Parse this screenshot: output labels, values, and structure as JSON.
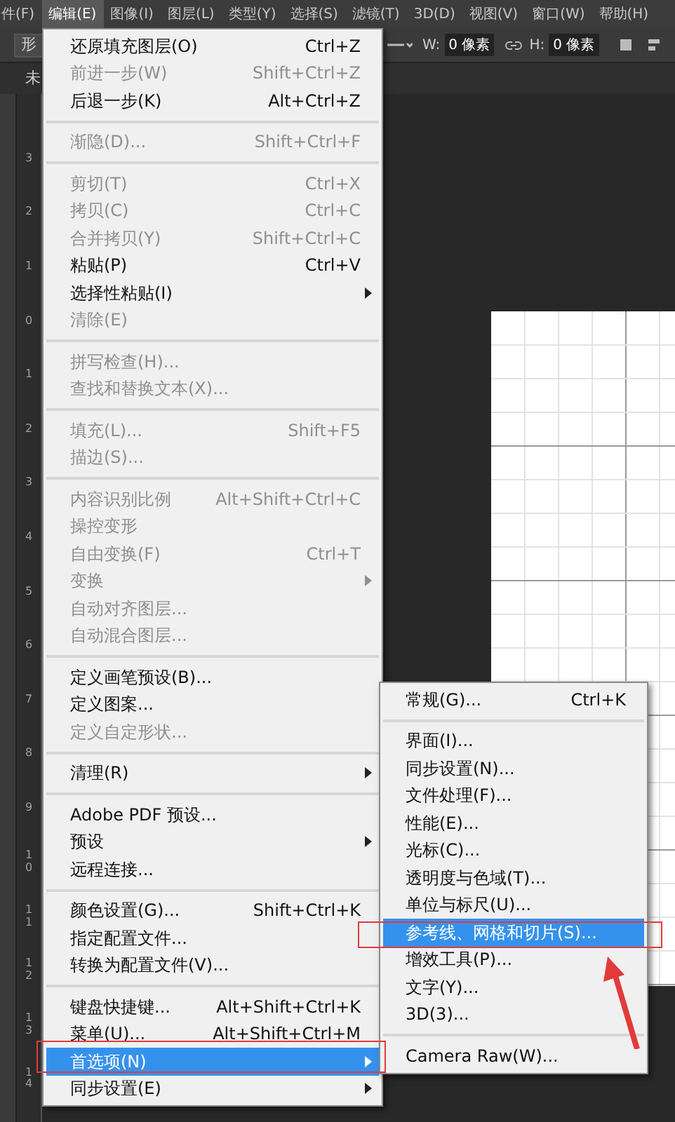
{
  "menubar": [
    {
      "label": "件(F)",
      "selected": false
    },
    {
      "label": "编辑(E)",
      "selected": true
    },
    {
      "label": "图像(I)",
      "selected": false
    },
    {
      "label": "图层(L)",
      "selected": false
    },
    {
      "label": "类型(Y)",
      "selected": false
    },
    {
      "label": "选择(S)",
      "selected": false
    },
    {
      "label": "滤镜(T)",
      "selected": false
    },
    {
      "label": "3D(D)",
      "selected": false
    },
    {
      "label": "视图(V)",
      "selected": false
    },
    {
      "label": "窗口(W)",
      "selected": false
    },
    {
      "label": "帮助(H)",
      "selected": false
    }
  ],
  "options_bar": {
    "tool": "形",
    "width_label": "W:",
    "width_value": "0 像素",
    "height_label": "H:",
    "height_value": "0 像素"
  },
  "document_tab": "未",
  "ruler": [
    "3",
    "2",
    "1",
    "0",
    "1",
    "2",
    "3",
    "4",
    "5",
    "6",
    "7",
    "8",
    "9",
    "10",
    "11",
    "12",
    "13",
    "14"
  ],
  "edit_menu": {
    "groups": [
      [
        {
          "label": "还原填充图层(O)",
          "shortcut": "Ctrl+Z",
          "disabled": false,
          "submenu": false,
          "selected": false
        },
        {
          "label": "前进一步(W)",
          "shortcut": "Shift+Ctrl+Z",
          "disabled": true,
          "submenu": false,
          "selected": false
        },
        {
          "label": "后退一步(K)",
          "shortcut": "Alt+Ctrl+Z",
          "disabled": false,
          "submenu": false,
          "selected": false
        }
      ],
      [
        {
          "label": "渐隐(D)...",
          "shortcut": "Shift+Ctrl+F",
          "disabled": true,
          "submenu": false,
          "selected": false
        }
      ],
      [
        {
          "label": "剪切(T)",
          "shortcut": "Ctrl+X",
          "disabled": true,
          "submenu": false,
          "selected": false
        },
        {
          "label": "拷贝(C)",
          "shortcut": "Ctrl+C",
          "disabled": true,
          "submenu": false,
          "selected": false
        },
        {
          "label": "合并拷贝(Y)",
          "shortcut": "Shift+Ctrl+C",
          "disabled": true,
          "submenu": false,
          "selected": false
        },
        {
          "label": "粘贴(P)",
          "shortcut": "Ctrl+V",
          "disabled": false,
          "submenu": false,
          "selected": false
        },
        {
          "label": "选择性粘贴(I)",
          "disabled": false,
          "submenu": true,
          "selected": false
        },
        {
          "label": "清除(E)",
          "disabled": true,
          "submenu": false,
          "selected": false
        }
      ],
      [
        {
          "label": "拼写检查(H)...",
          "disabled": true,
          "submenu": false,
          "selected": false
        },
        {
          "label": "查找和替换文本(X)...",
          "disabled": true,
          "submenu": false,
          "selected": false
        }
      ],
      [
        {
          "label": "填充(L)...",
          "shortcut": "Shift+F5",
          "disabled": true,
          "submenu": false,
          "selected": false
        },
        {
          "label": "描边(S)...",
          "disabled": true,
          "submenu": false,
          "selected": false
        }
      ],
      [
        {
          "label": "内容识别比例",
          "shortcut": "Alt+Shift+Ctrl+C",
          "disabled": true,
          "submenu": false,
          "selected": false
        },
        {
          "label": "操控变形",
          "disabled": true,
          "submenu": false,
          "selected": false
        },
        {
          "label": "自由变换(F)",
          "shortcut": "Ctrl+T",
          "disabled": true,
          "submenu": false,
          "selected": false
        },
        {
          "label": "变换",
          "disabled": true,
          "submenu": true,
          "selected": false
        },
        {
          "label": "自动对齐图层...",
          "disabled": true,
          "submenu": false,
          "selected": false
        },
        {
          "label": "自动混合图层...",
          "disabled": true,
          "submenu": false,
          "selected": false
        }
      ],
      [
        {
          "label": "定义画笔预设(B)...",
          "disabled": false,
          "submenu": false,
          "selected": false
        },
        {
          "label": "定义图案...",
          "disabled": false,
          "submenu": false,
          "selected": false
        },
        {
          "label": "定义自定形状...",
          "disabled": true,
          "submenu": false,
          "selected": false
        }
      ],
      [
        {
          "label": "清理(R)",
          "disabled": false,
          "submenu": true,
          "selected": false
        }
      ],
      [
        {
          "label": "Adobe PDF 预设...",
          "disabled": false,
          "submenu": false,
          "selected": false
        },
        {
          "label": "预设",
          "disabled": false,
          "submenu": true,
          "selected": false
        },
        {
          "label": "远程连接...",
          "disabled": false,
          "submenu": false,
          "selected": false
        }
      ],
      [
        {
          "label": "颜色设置(G)...",
          "shortcut": "Shift+Ctrl+K",
          "disabled": false,
          "submenu": false,
          "selected": false
        },
        {
          "label": "指定配置文件...",
          "disabled": false,
          "submenu": false,
          "selected": false
        },
        {
          "label": "转换为配置文件(V)...",
          "disabled": false,
          "submenu": false,
          "selected": false
        }
      ],
      [
        {
          "label": "键盘快捷键...",
          "shortcut": "Alt+Shift+Ctrl+K",
          "disabled": false,
          "submenu": false,
          "selected": false
        },
        {
          "label": "菜单(U)...",
          "shortcut": "Alt+Shift+Ctrl+M",
          "disabled": false,
          "submenu": false,
          "selected": false
        },
        {
          "label": "首选项(N)",
          "disabled": false,
          "submenu": true,
          "selected": true
        },
        {
          "label": "同步设置(E)",
          "disabled": false,
          "submenu": true,
          "selected": false
        }
      ]
    ]
  },
  "preferences_submenu": {
    "groups": [
      [
        {
          "label": "常规(G)...",
          "shortcut": "Ctrl+K",
          "disabled": false,
          "submenu": false,
          "selected": false
        }
      ],
      [
        {
          "label": "界面(I)...",
          "disabled": false,
          "submenu": false,
          "selected": false
        },
        {
          "label": "同步设置(N)...",
          "disabled": false,
          "submenu": false,
          "selected": false
        },
        {
          "label": "文件处理(F)...",
          "disabled": false,
          "submenu": false,
          "selected": false
        },
        {
          "label": "性能(E)...",
          "disabled": false,
          "submenu": false,
          "selected": false
        },
        {
          "label": "光标(C)...",
          "disabled": false,
          "submenu": false,
          "selected": false
        },
        {
          "label": "透明度与色域(T)...",
          "disabled": false,
          "submenu": false,
          "selected": false
        },
        {
          "label": "单位与标尺(U)...",
          "disabled": false,
          "submenu": false,
          "selected": false
        },
        {
          "label": "参考线、网格和切片(S)...",
          "disabled": false,
          "submenu": false,
          "selected": true
        },
        {
          "label": "增效工具(P)...",
          "disabled": false,
          "submenu": false,
          "selected": false
        },
        {
          "label": "文字(Y)...",
          "disabled": false,
          "submenu": false,
          "selected": false
        },
        {
          "label": "3D(3)...",
          "disabled": false,
          "submenu": false,
          "selected": false
        }
      ],
      [
        {
          "label": "Camera Raw(W)...",
          "disabled": false,
          "submenu": false,
          "selected": false
        }
      ]
    ]
  }
}
